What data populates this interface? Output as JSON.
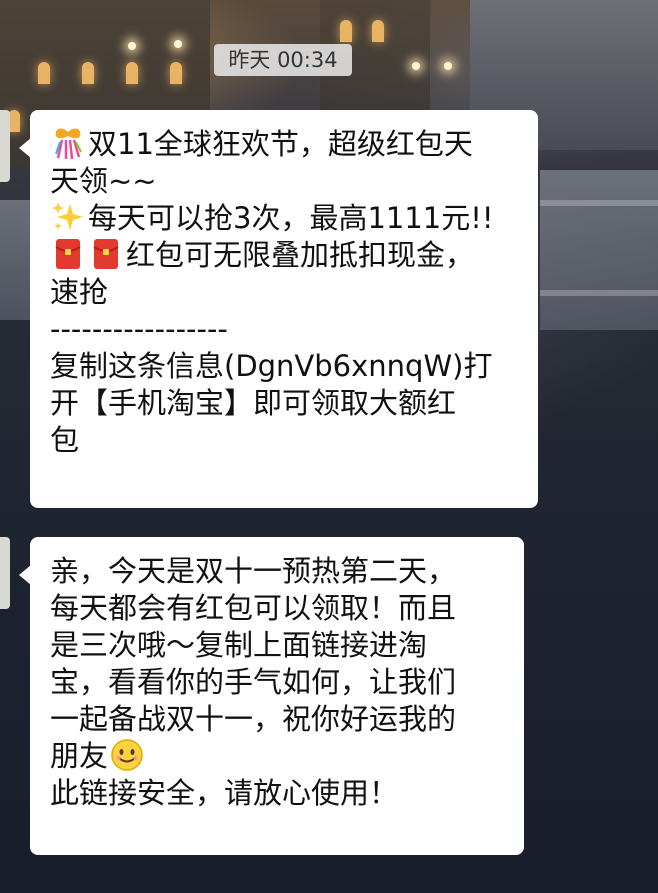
{
  "chat": {
    "timestamp": "昨天 00:34",
    "messages": [
      {
        "lines": [
          {
            "emoji": "ribbon-gift-icon",
            "text": "双11全球狂欢节，超级红包天"
          },
          {
            "text": "天领~~"
          },
          {
            "emoji": "sparkles-icon",
            "text": "每天可以抢3次，最高1111元!!"
          },
          {
            "emoji": "red-envelope-icon",
            "emoji2": "red-envelope-icon",
            "text": "红包可无限叠加抵扣现金，"
          },
          {
            "text": "速抢"
          },
          {
            "text": "-----------------"
          },
          {
            "text": "复制这条信息(DgnVb6xnnqW)打"
          },
          {
            "text": "开【手机淘宝】即可领取大额红"
          },
          {
            "text": "包"
          }
        ]
      },
      {
        "lines": [
          {
            "text": "亲，今天是双十一预热第二天，"
          },
          {
            "text": "每天都会有红包可以领取！而且"
          },
          {
            "text": "是三次哦～复制上面链接进淘"
          },
          {
            "text": "宝，看看你的手气如何，让我们"
          },
          {
            "text": "一起备战双十一，祝你好运我的"
          },
          {
            "text": "朋友",
            "emoji_after": "smiling-face-icon"
          },
          {
            "text": "此链接安全，请放心使用！"
          }
        ]
      }
    ]
  },
  "colors": {
    "bubble": "#ffffff",
    "timestamp_bg": "#e6e6e6",
    "text": "#111111",
    "red_envelope": "#e23a2e"
  }
}
